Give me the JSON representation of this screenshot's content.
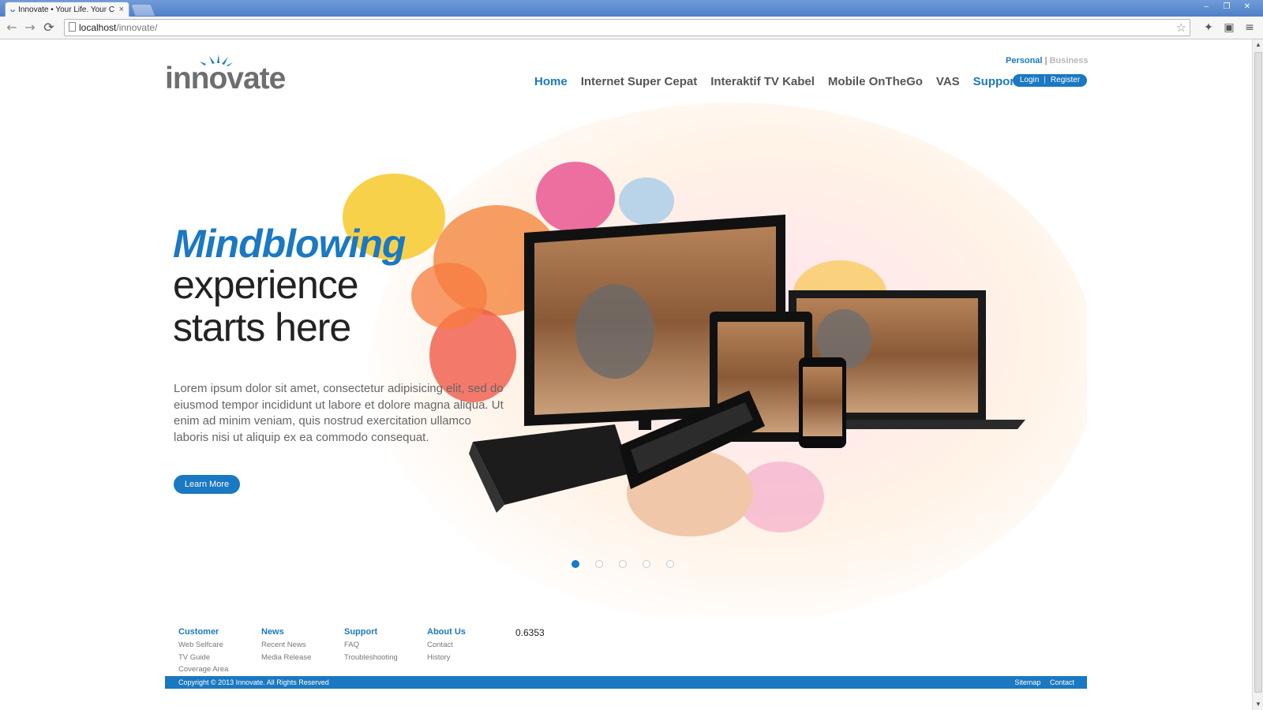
{
  "browser": {
    "tab_title": "Innovate • Your Life. Your C",
    "tab_close": "×",
    "url_host": "localhost",
    "url_path": "/innovate/",
    "back": "←",
    "forward": "→",
    "reload": "⟳",
    "star": "☆",
    "menu": "≡",
    "minimize": "‒",
    "restore": "❐",
    "close": "✕"
  },
  "header": {
    "logo_text": "innovate",
    "segment_personal": "Personal",
    "segment_sep": "|",
    "segment_business": "Business",
    "nav": [
      "Home",
      "Internet Super Cepat",
      "Interaktif TV Kabel",
      "Mobile OnTheGo",
      "VAS",
      "Support"
    ],
    "login": "Login",
    "auth_sep": "|",
    "register": "Register"
  },
  "hero": {
    "title_highlight": "Mindblowing",
    "title_line2": "experience",
    "title_line3": "starts here",
    "body": "Lorem ipsum dolor sit amet, consectetur adipisicing elit, sed do eiusmod tempor incididunt ut labore et dolore magna aliqua. Ut enim ad minim veniam, quis nostrud exercitation ullamco laboris nisi ut aliquip ex ea commodo consequat.",
    "cta": "Learn More",
    "slides_total": 5,
    "active_slide": 1
  },
  "footer": {
    "columns": [
      {
        "title": "Customer",
        "links": [
          "Web Selfcare",
          "TV Guide",
          "Coverage Area"
        ]
      },
      {
        "title": "News",
        "links": [
          "Recent News",
          "Media Release"
        ]
      },
      {
        "title": "Support",
        "links": [
          "FAQ",
          "Troubleshooting"
        ]
      },
      {
        "title": "About Us",
        "links": [
          "Contact",
          "History"
        ]
      }
    ],
    "number": "0.6353",
    "copyright": "Copyright © 2013 Innovate. All Rights Reserved",
    "sitemap": "Sitemap",
    "contact": "Contact"
  },
  "colors": {
    "brand_blue": "#1b78c2",
    "nav_gray": "#555555"
  }
}
